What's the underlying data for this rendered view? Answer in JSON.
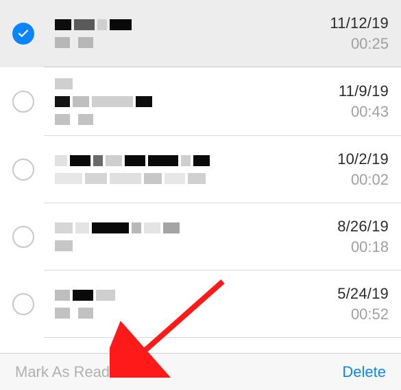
{
  "rows": [
    {
      "selected": true,
      "date": "11/12/19",
      "time": "00:25"
    },
    {
      "selected": false,
      "date": "11/9/19",
      "time": "00:43"
    },
    {
      "selected": false,
      "date": "10/2/19",
      "time": "00:02"
    },
    {
      "selected": false,
      "date": "8/26/19",
      "time": "00:18"
    },
    {
      "selected": false,
      "date": "5/24/19",
      "time": "00:52"
    }
  ],
  "toolbar": {
    "mark_label": "Mark As Read",
    "delete_label": "Delete"
  }
}
